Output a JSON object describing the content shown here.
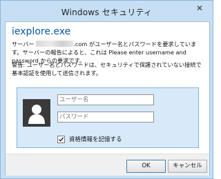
{
  "window": {
    "title": "Windows セキュリティ"
  },
  "header": {
    "app_name": "iexplore.exe"
  },
  "message": {
    "prefix": "サーバー ",
    "suffix": ".com がユーザー名とパスワードを要求しています。サーバーの報告によると、これは Please enter username and password からの要求です。",
    "warning": "警告: ユーザー名とパスワードは、セキュリティで保護されていない接続で基本認証を使用して送信されます。"
  },
  "credentials": {
    "username_placeholder": "ユーザー名",
    "password_placeholder": "パスワード",
    "remember_label": "資格情報を記憶する",
    "remember_checked": true
  },
  "buttons": {
    "ok": "OK",
    "cancel": "キャンセル"
  },
  "icons": [
    "close-icon",
    "user-avatar-icon",
    "checkmark-icon"
  ],
  "colors": {
    "title_link": "#0b57a4",
    "panel_bg": "#d8eaf9",
    "window_frame": "#c7dff4"
  }
}
